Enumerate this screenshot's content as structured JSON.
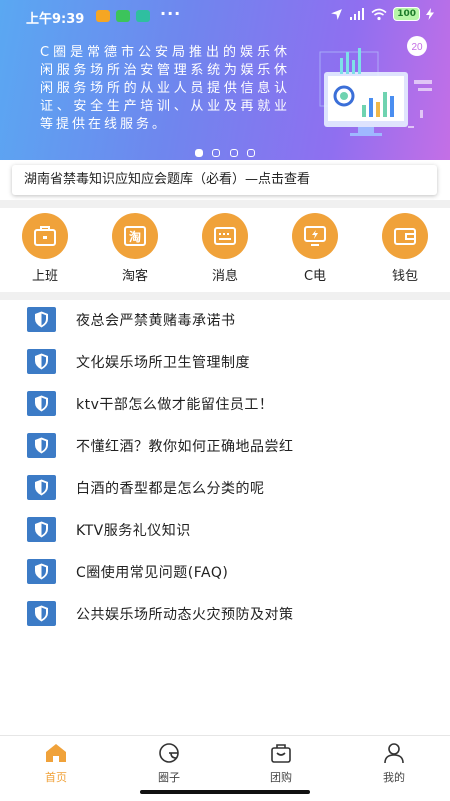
{
  "status_bar": {
    "time": "上午9:39",
    "battery": "100"
  },
  "banner": {
    "text": "C圈是常德市公安局推出的娱乐休闲服务场所治安管理系统为娱乐休闲服务场所的从业人员提供信息认证、安全生产培训、从业及再就业等提供在线服务。",
    "badge": "20",
    "slides": 4,
    "active_slide": 1
  },
  "notice": {
    "text": "湖南省禁毒知识应知应会题库（必看）—点击查看"
  },
  "shortcuts": [
    {
      "label": "上班",
      "icon": "briefcase-icon"
    },
    {
      "label": "淘客",
      "icon": "taobao-icon"
    },
    {
      "label": "消息",
      "icon": "message-icon"
    },
    {
      "label": "C电",
      "icon": "monitor-icon"
    },
    {
      "label": "钱包",
      "icon": "wallet-icon"
    }
  ],
  "articles": [
    {
      "title": "夜总会严禁黄赌毒承诺书"
    },
    {
      "title": "文化娱乐场所卫生管理制度"
    },
    {
      "title": "ktv干部怎么做才能留住员工！"
    },
    {
      "title": "不懂红酒？教你如何正确地品尝红"
    },
    {
      "title": "白酒的香型都是怎么分类的呢"
    },
    {
      "title": "KTV服务礼仪知识"
    },
    {
      "title": "C圈使用常见问题(FAQ)"
    },
    {
      "title": "公共娱乐场所动态火灾预防及对策"
    }
  ],
  "bottom_nav": [
    {
      "label": "首页",
      "icon": "home-icon",
      "active": true
    },
    {
      "label": "圈子",
      "icon": "circle-icon",
      "active": false
    },
    {
      "label": "团购",
      "icon": "bag-icon",
      "active": false
    },
    {
      "label": "我的",
      "icon": "user-icon",
      "active": false
    }
  ],
  "colors": {
    "accent": "#f0a23a",
    "list_icon": "#3c7bc6"
  }
}
